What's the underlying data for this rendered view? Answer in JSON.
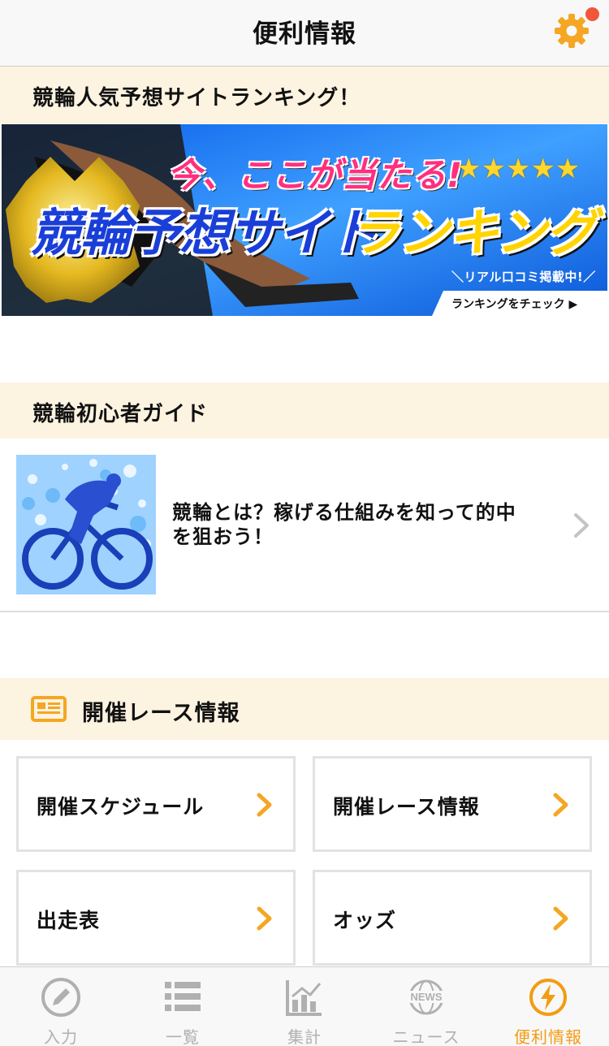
{
  "nav": {
    "title": "便利情報",
    "settings_icon": "gear-icon",
    "badge_color": "#f2563b"
  },
  "sections": {
    "ranking_title": "競輪人気予想サイトランキング！",
    "guide_title": "競輪初心者ガイド",
    "race_info_title": "開催レース情報"
  },
  "banner": {
    "line1": "今、ここが当たる!",
    "stars": "★★★★★",
    "line2a": "競輪予想サイト",
    "line2b": "ランキング",
    "line3": "＼リアル口コミ掲載中!／",
    "cta": "ランキングをチェック ▶"
  },
  "guide": {
    "text": "競輪とは？稼げる仕組みを知って的中を狙おう！"
  },
  "race_buttons": [
    {
      "label": "開催スケジュール"
    },
    {
      "label": "開催レース情報"
    },
    {
      "label": "出走表"
    },
    {
      "label": "オッズ"
    }
  ],
  "tabs": [
    {
      "label": "入力",
      "icon": "pencil-icon",
      "active": false
    },
    {
      "label": "一覧",
      "icon": "list-icon",
      "active": false
    },
    {
      "label": "集計",
      "icon": "chart-icon",
      "active": false
    },
    {
      "label": "ニュース",
      "icon": "news-globe-icon",
      "active": false
    },
    {
      "label": "便利情報",
      "icon": "lightning-icon",
      "active": true
    }
  ],
  "colors": {
    "accent": "#f39c12",
    "section_bg": "#fcf3e0",
    "inactive": "#b0b0b0"
  }
}
